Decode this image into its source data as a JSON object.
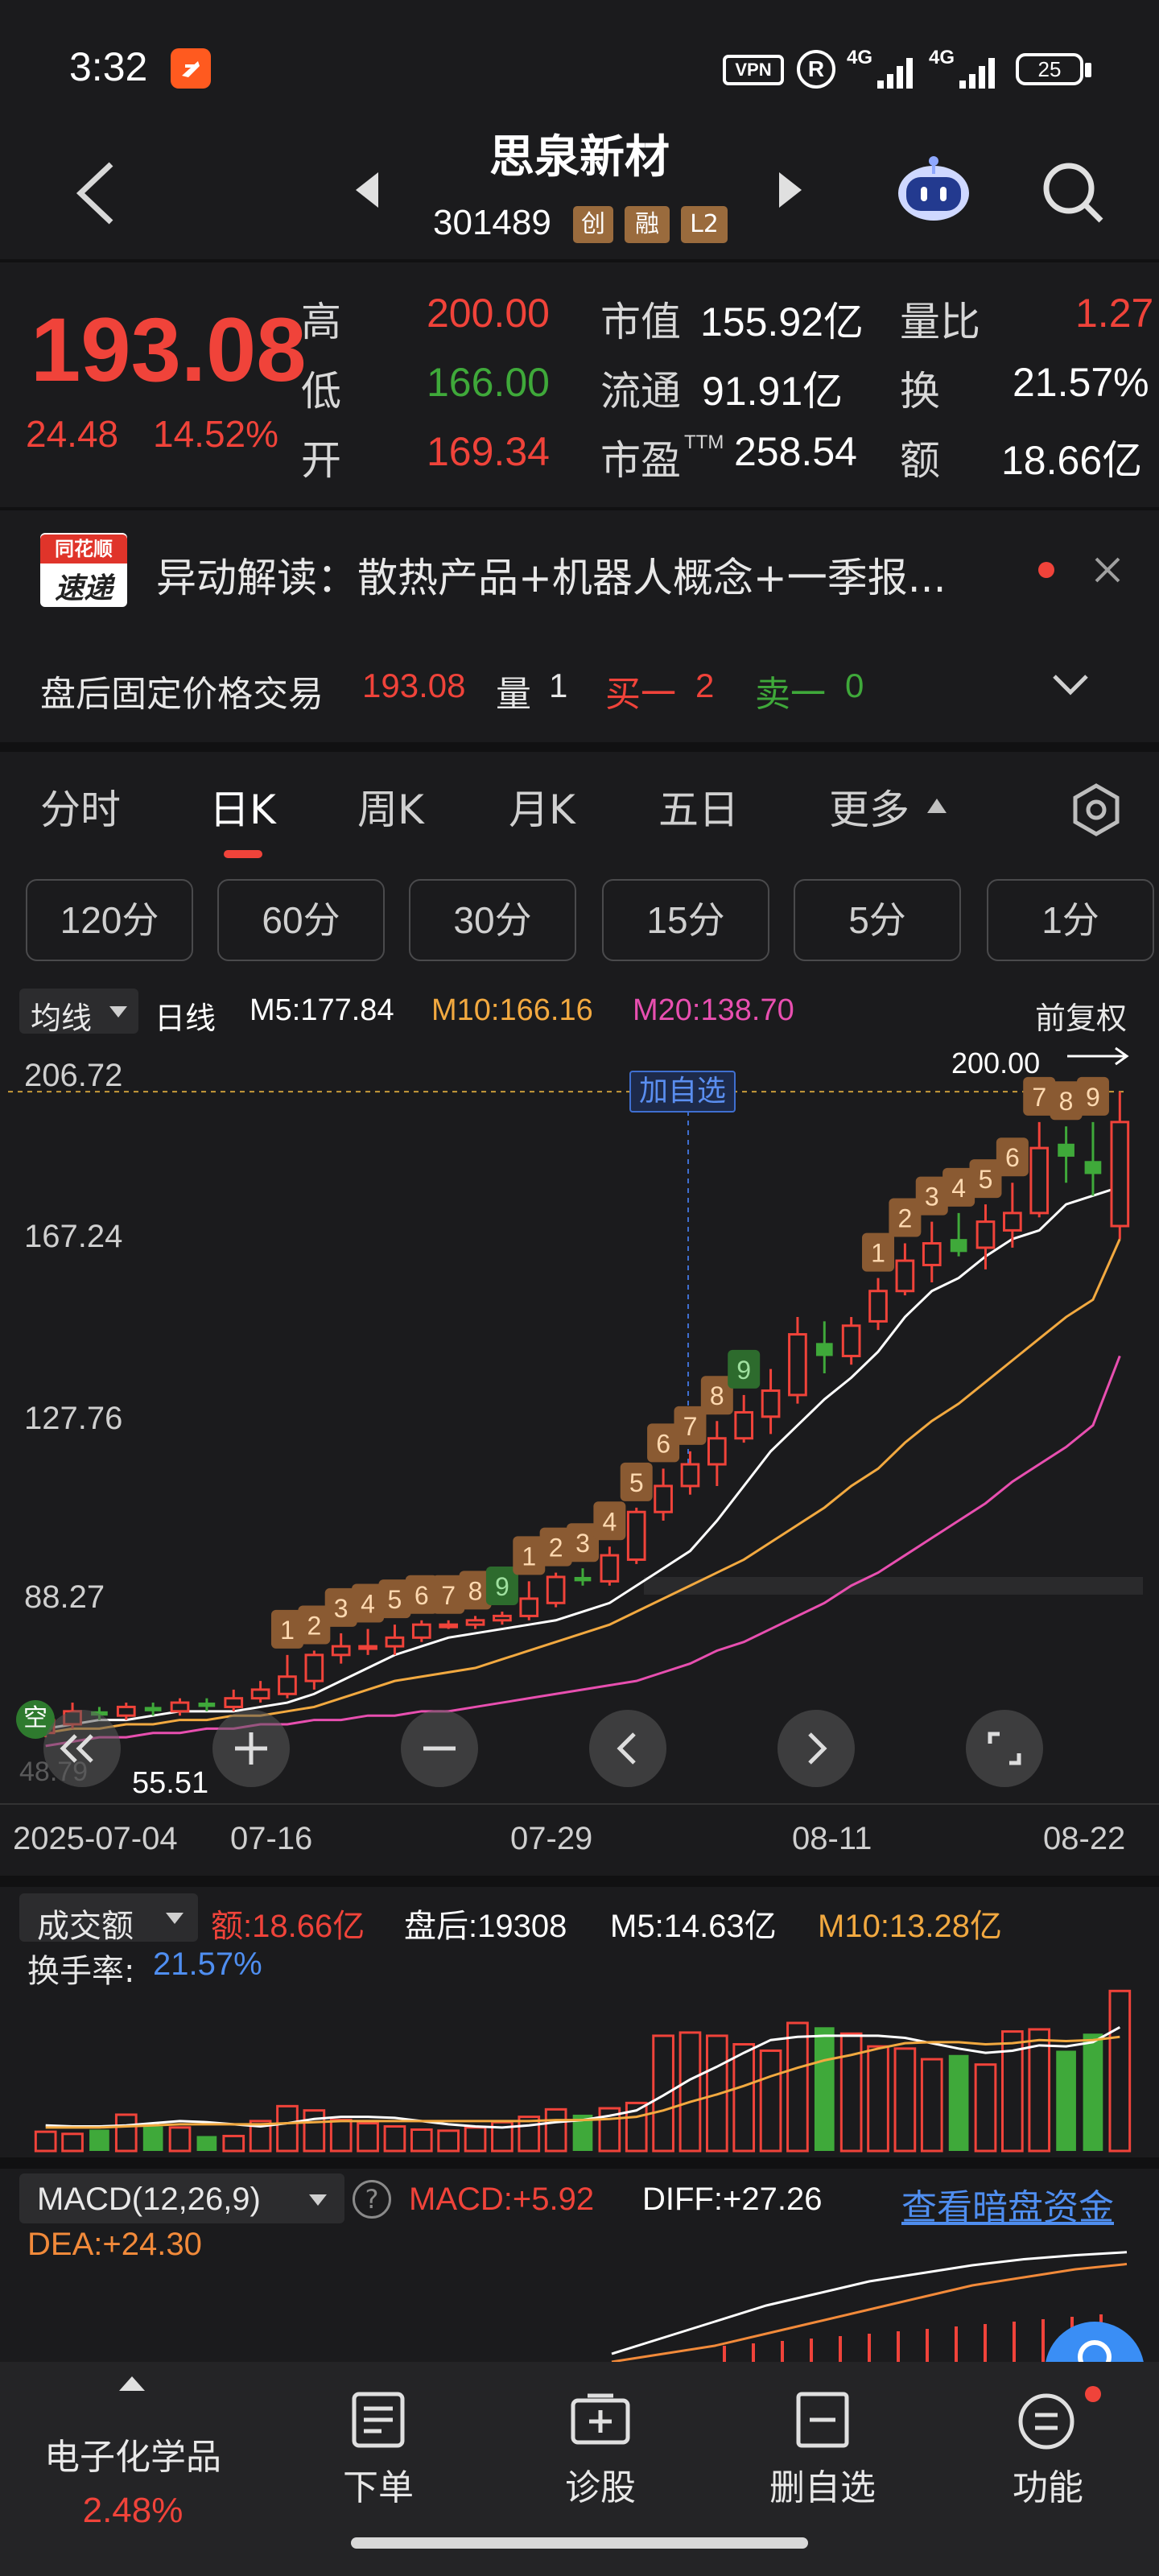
{
  "status_bar": {
    "time": "3:32",
    "vpn": "VPN",
    "r_badge": "R",
    "net1": "4G",
    "net2": "4G",
    "battery": "25"
  },
  "header": {
    "title": "思泉新材",
    "code": "301489",
    "tags": [
      "创",
      "融",
      "L2"
    ]
  },
  "quote": {
    "price": "193.08",
    "change": "24.48",
    "change_pct": "14.52%",
    "high_label": "高",
    "high": "200.00",
    "low_label": "低",
    "low": "166.00",
    "open_label": "开",
    "open": "169.34",
    "mktcap_label": "市值",
    "mktcap": "155.92亿",
    "float_label": "流通",
    "float": "91.91亿",
    "pe_label": "市盈",
    "pe_sup": "TTM",
    "pe": "258.54",
    "volratio_label": "量比",
    "volratio": "1.27",
    "turnover_label": "换",
    "turnover": "21.57%",
    "amount_label": "额",
    "amount": "18.66亿"
  },
  "news": {
    "logo_top": "同花顺",
    "logo_bottom": "速递",
    "text": "异动解读：散热产品+机器人概念+一季报..."
  },
  "after_hours": {
    "label": "盘后固定价格交易",
    "price": "193.08",
    "vol_label": "量",
    "vol": "1",
    "buy_label": "买一",
    "buy": "2",
    "sell_label": "卖一",
    "sell": "0"
  },
  "period_tabs": [
    "分时",
    "日K",
    "周K",
    "月K",
    "五日",
    "更多"
  ],
  "minute_tabs": [
    "120分",
    "60分",
    "30分",
    "15分",
    "5分",
    "1分"
  ],
  "kline_legend": {
    "ma_select": "均线",
    "period": "日线",
    "m5": "M5:177.84",
    "m10": "M10:166.16",
    "m20": "M20:138.70",
    "adjust": "前复权"
  },
  "kline_axis": {
    "y_ticks": [
      "206.72",
      "167.24",
      "127.76",
      "88.27"
    ],
    "low_label_partial": "48.79",
    "x_ticks": [
      "2025-07-04",
      "07-16",
      "07-29",
      "08-11",
      "08-22"
    ],
    "high_marker": "200.00",
    "low_marker": "55.51",
    "add_watch": "加自选",
    "empty_badge": "空"
  },
  "volume_legend": {
    "select": "成交额",
    "amount": "额:18.66亿",
    "after": "盘后:19308",
    "m5": "M5:14.63亿",
    "m10": "M10:13.28亿",
    "turnover_label": "换手率:",
    "turnover": "21.57%"
  },
  "macd_legend": {
    "select": "MACD(12,26,9)",
    "help": "?",
    "macd": "MACD:+5.92",
    "diff": "DIFF:+27.26",
    "link": "查看暗盘资金",
    "dea": "DEA:+24.30"
  },
  "bottom_nav": {
    "sector_name": "电子化学品",
    "sector_change": "2.48%",
    "order": "下单",
    "diagnose": "诊股",
    "remove_watch": "删自选",
    "functions": "功能"
  },
  "colors": {
    "up": "#f0433a",
    "down": "#3fa93a",
    "ma5": "#ffffff",
    "ma10": "#f2a940",
    "ma20": "#e84fb0",
    "tag": "#9a6b3d",
    "link": "#4f8ef0"
  },
  "chart_data": [
    {
      "type": "candlestick",
      "title": "",
      "x_ticks": [
        "2025-07-04",
        "07-16",
        "07-29",
        "08-11",
        "08-22"
      ],
      "y_ticks": [
        206.72,
        167.24,
        127.76,
        88.27
      ],
      "ylim": [
        48.79,
        206.72
      ],
      "candles": [
        [
          52,
          55,
          51,
          58
        ],
        [
          54,
          57,
          53,
          59
        ],
        [
          57,
          56,
          55,
          58
        ],
        [
          56,
          58,
          55,
          59
        ],
        [
          58,
          57,
          56,
          59
        ],
        [
          57,
          59,
          56,
          60
        ],
        [
          59,
          58,
          57,
          60
        ],
        [
          58,
          60,
          57,
          62
        ],
        [
          60,
          62,
          59,
          64
        ],
        [
          61,
          65,
          60,
          70
        ],
        [
          64,
          70,
          62,
          71
        ],
        [
          70,
          72,
          68,
          75
        ],
        [
          72,
          72,
          70,
          76
        ],
        [
          72,
          74,
          70,
          77
        ],
        [
          74,
          77,
          73,
          78
        ],
        [
          77,
          77,
          76,
          78
        ],
        [
          77,
          78,
          76,
          79
        ],
        [
          78,
          79,
          77,
          80
        ],
        [
          79,
          83,
          78,
          87
        ],
        [
          82,
          88,
          81,
          89
        ],
        [
          88,
          87,
          86,
          90
        ],
        [
          87,
          93,
          86,
          95
        ],
        [
          92,
          103,
          91,
          104
        ],
        [
          103,
          109,
          101,
          113
        ],
        [
          109,
          114,
          107,
          117
        ],
        [
          114,
          120,
          109,
          124
        ],
        [
          120,
          126,
          119,
          130
        ],
        [
          125,
          131,
          121,
          136
        ],
        [
          130,
          144,
          128,
          148
        ],
        [
          142,
          139,
          135,
          147
        ],
        [
          139,
          146,
          137,
          148
        ],
        [
          147,
          154,
          145,
          157
        ],
        [
          154,
          161,
          153,
          165
        ],
        [
          160,
          165,
          156,
          170
        ],
        [
          166,
          163,
          162,
          172
        ],
        [
          164,
          170,
          159,
          174
        ],
        [
          168,
          172,
          164,
          179
        ],
        [
          172,
          187,
          171,
          193
        ],
        [
          188,
          185,
          179,
          192
        ],
        [
          184,
          181,
          176,
          193
        ],
        [
          169,
          193,
          166,
          200
        ]
      ],
      "ma_series": [
        {
          "name": "M5",
          "values": [
            53,
            54,
            55,
            55,
            56,
            57,
            57,
            57,
            58,
            59,
            61,
            64,
            67,
            70,
            72,
            74,
            75,
            76,
            77,
            78,
            80,
            82,
            86,
            90,
            94,
            101,
            109,
            117,
            123,
            129,
            134,
            140,
            148,
            154,
            157,
            162,
            166,
            168,
            174,
            176,
            178
          ]
        },
        {
          "name": "M10",
          "values": [
            52,
            53,
            53,
            54,
            54,
            55,
            55,
            56,
            56,
            57,
            58,
            60,
            62,
            64,
            65,
            66,
            67,
            69,
            71,
            73,
            75,
            77,
            80,
            83,
            86,
            89,
            92,
            96,
            100,
            104,
            109,
            113,
            119,
            124,
            128,
            133,
            138,
            143,
            148,
            152,
            166
          ]
        },
        {
          "name": "M20",
          "values": [
            49,
            50,
            51,
            51,
            52,
            52,
            53,
            53,
            54,
            54,
            55,
            55,
            56,
            56,
            57,
            57,
            58,
            59,
            60,
            61,
            62,
            63,
            64,
            66,
            68,
            71,
            73,
            76,
            79,
            82,
            86,
            89,
            93,
            97,
            101,
            105,
            110,
            114,
            118,
            123,
            139
          ]
        }
      ],
      "signal_labels": [
        "1",
        "2",
        "3",
        "4",
        "5",
        "6",
        "7",
        "8",
        "9",
        "1",
        "2",
        "3",
        "4",
        "5",
        "6",
        "7",
        "8",
        "9",
        "1",
        "2",
        "3",
        "4",
        "5",
        "6",
        "7",
        "8",
        "9"
      ],
      "high_marker": 200.0,
      "low_marker": 55.51
    },
    {
      "type": "bar",
      "title": "成交额",
      "values": [
        18,
        16,
        20,
        34,
        23,
        22,
        14,
        14,
        28,
        42,
        38,
        29,
        26,
        23,
        20,
        19,
        22,
        27,
        32,
        39,
        34,
        40,
        45,
        108,
        111,
        108,
        100,
        94,
        120,
        116,
        110,
        98,
        96,
        86,
        90,
        81,
        112,
        114,
        94,
        110,
        150
      ],
      "series": [
        {
          "name": "M5",
          "values": [
            24,
            23,
            23,
            24,
            26,
            28,
            27,
            25,
            23,
            26,
            30,
            32,
            32,
            31,
            28,
            25,
            23,
            22,
            24,
            27,
            29,
            33,
            38,
            52,
            67,
            79,
            92,
            104,
            107,
            108,
            108,
            108,
            106,
            101,
            96,
            92,
            94,
            99,
            98,
            102,
            116
          ]
        },
        {
          "name": "M10",
          "values": [
            22,
            22,
            22,
            23,
            24,
            25,
            25,
            25,
            25,
            26,
            27,
            28,
            28,
            28,
            28,
            28,
            28,
            28,
            28,
            29,
            29,
            30,
            32,
            38,
            46,
            53,
            61,
            70,
            78,
            85,
            90,
            96,
            101,
            102,
            102,
            100,
            101,
            104,
            103,
            104,
            107
          ]
        }
      ]
    },
    {
      "type": "line",
      "title": "MACD(12,26,9)",
      "series": [
        {
          "name": "DIFF",
          "values": [
            2,
            6,
            10,
            14,
            17,
            20,
            22,
            24,
            25.5,
            26.5,
            27.26
          ]
        },
        {
          "name": "DEA",
          "values": [
            0,
            2,
            4,
            7,
            10,
            13,
            16,
            19,
            21,
            23,
            24.3
          ]
        }
      ]
    }
  ]
}
